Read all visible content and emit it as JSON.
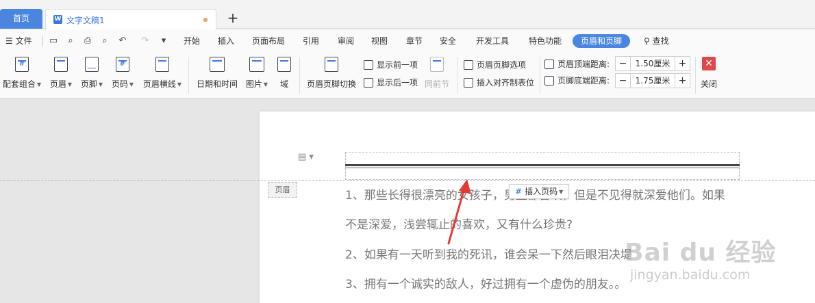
{
  "tabs": {
    "home": "首页",
    "doc_title": "文字文稿1",
    "add": "+"
  },
  "menu": {
    "file": "文件",
    "items": [
      "开始",
      "插入",
      "页面布局",
      "引用",
      "审阅",
      "视图",
      "章节",
      "安全",
      "开发工具",
      "特色功能",
      "页眉和页脚"
    ],
    "search": "查找"
  },
  "ribbon": {
    "combo": "配套组合",
    "header": "页眉",
    "footer": "页脚",
    "pagenum": "页码",
    "header_line": "页眉横线",
    "datetime": "日期和时间",
    "picture": "图片",
    "field": "域",
    "toggle": "页眉页脚切换",
    "show_prev": "显示前一项",
    "show_next": "显示后一项",
    "same_prev": "同前节",
    "hf_options": "页眉页脚选项",
    "insert_tab": "插入对齐制表位",
    "top_dist_label": "页眉顶端距离:",
    "top_dist_value": "1.50厘米",
    "bottom_dist_label": "页脚底端距离:",
    "bottom_dist_value": "1.75厘米",
    "close": "关闭"
  },
  "document": {
    "header_tag": "页眉",
    "insert_page_number": "插入页码",
    "lines": [
      "1、那些长得很漂亮的女孩子，男生都喜欢，但是不见得就深爱他们。如果",
      "不是深爱，浅尝辄止的喜欢，又有什么珍贵?",
      "2、如果有一天听到我的死讯，谁会呆一下然后眼泪决堤",
      "3、拥有一个诚实的敌人，好过拥有一个虚伪的朋友。。"
    ]
  },
  "watermark": {
    "main": "Bai du 经验",
    "sub": "jingyan.baidu.com"
  },
  "colors": {
    "accent": "#4a86e0",
    "close": "#e04747",
    "arrow": "#e53935"
  }
}
